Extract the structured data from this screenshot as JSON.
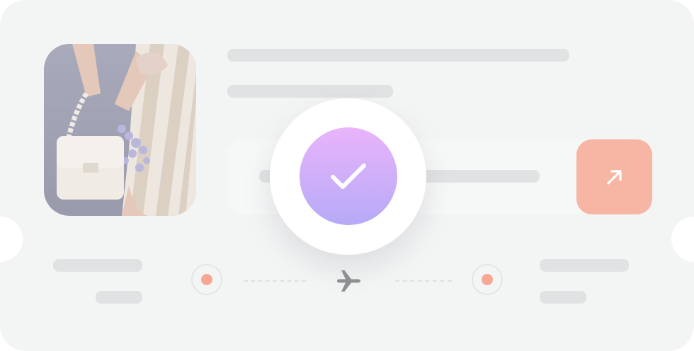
{
  "illustration": {
    "type": "ticket-confirmation",
    "colors": {
      "card_background": "#f3f4f4",
      "placeholder_bar": "#e1e2e3",
      "accent_salmon": "#f7b5a4",
      "dot_salmon": "#f6a894",
      "check_gradient_top": "#e9b4fb",
      "check_gradient_bottom": "#b6aaf7"
    },
    "icons": {
      "confirm": "check-icon",
      "action": "arrow-up-right-icon",
      "route": "airplane-icon",
      "origin": "origin-dot-icon",
      "destination": "destination-dot-icon"
    },
    "photo_subject": "handbag-with-lavender"
  }
}
